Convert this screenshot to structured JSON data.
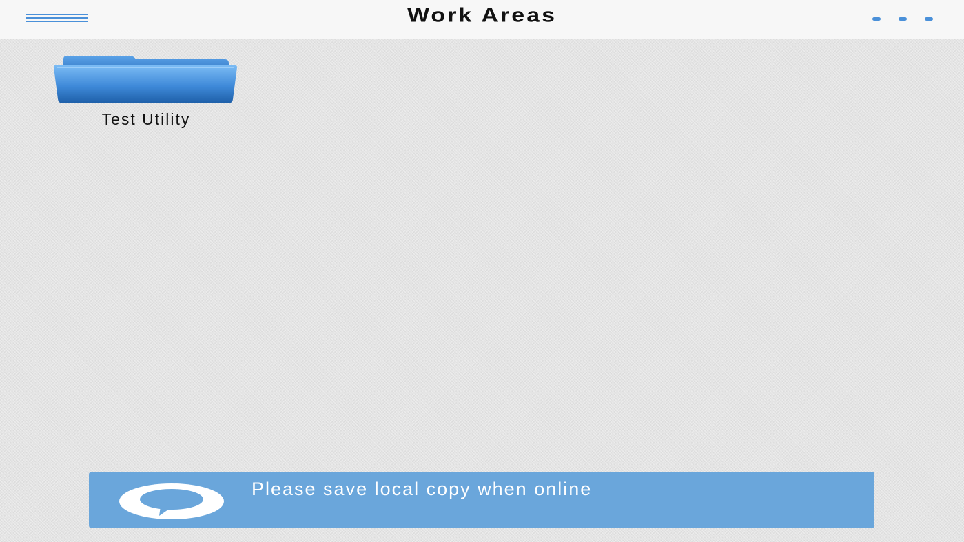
{
  "header": {
    "title": "Work Areas",
    "menu_icon": "hamburger-menu-icon",
    "more_icon": "more-options-icon"
  },
  "folders": [
    {
      "label": "Test Utility",
      "icon": "folder-icon"
    }
  ],
  "toast": {
    "message": "Please save local copy when online",
    "icon": "speech-bubble-icon"
  },
  "colors": {
    "accent": "#4a90d9",
    "toast_background": "#6aa6db",
    "folder_light": "#6db3f2",
    "folder_dark": "#1e5fa8",
    "header_background": "#f7f7f7"
  }
}
